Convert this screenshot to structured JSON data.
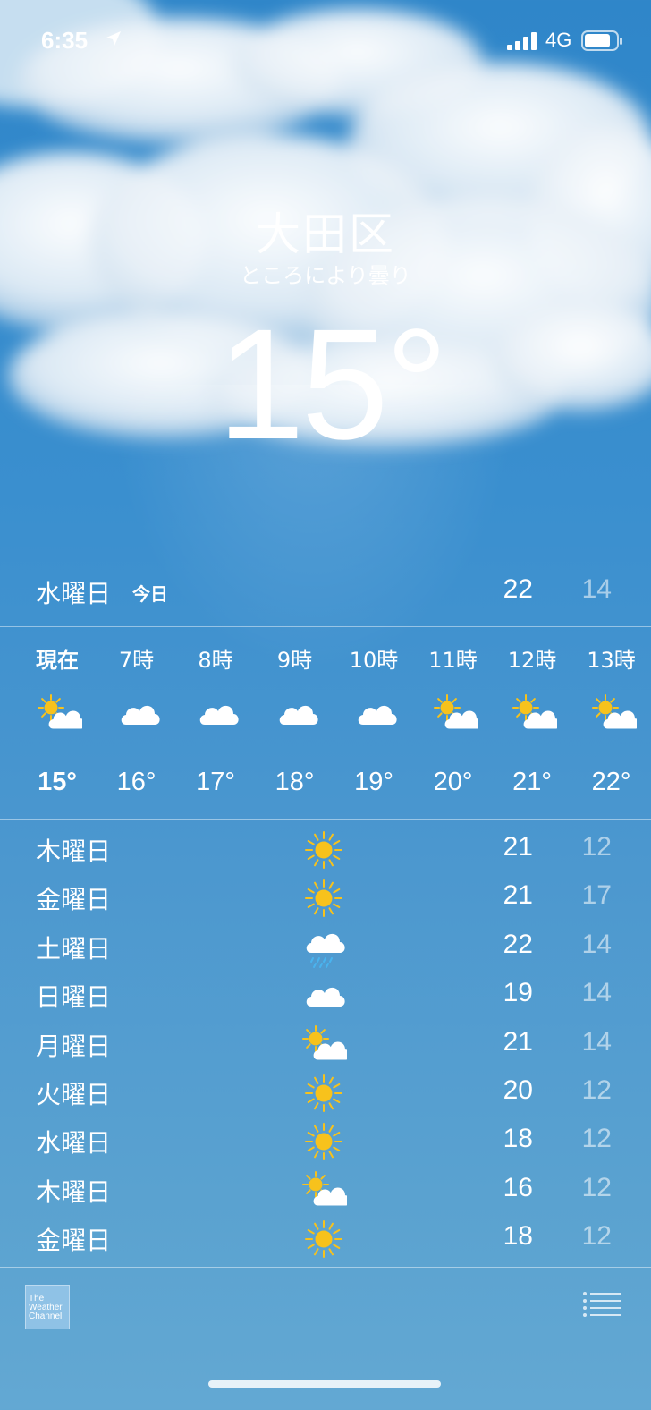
{
  "status_bar": {
    "time": "6:35",
    "network": "4G"
  },
  "location": {
    "city": "大田区",
    "condition": "ところにより曇り",
    "temperature": "15°"
  },
  "today": {
    "day": "水曜日",
    "label": "今日",
    "high": "22",
    "low": "14"
  },
  "hourly": [
    {
      "time": "現在",
      "icon": "partly-sunny-icon",
      "temp": "15°"
    },
    {
      "time": "7時",
      "icon": "cloud-icon",
      "temp": "16°"
    },
    {
      "time": "8時",
      "icon": "cloud-icon",
      "temp": "17°"
    },
    {
      "time": "9時",
      "icon": "cloud-icon",
      "temp": "18°"
    },
    {
      "time": "10時",
      "icon": "cloud-icon",
      "temp": "19°"
    },
    {
      "time": "11時",
      "icon": "partly-sunny-icon",
      "temp": "20°"
    },
    {
      "time": "12時",
      "icon": "partly-sunny-icon",
      "temp": "21°"
    },
    {
      "time": "13時",
      "icon": "partly-sunny-icon",
      "temp": "22°"
    }
  ],
  "daily": [
    {
      "day": "木曜日",
      "icon": "sun-icon",
      "high": "21",
      "low": "12"
    },
    {
      "day": "金曜日",
      "icon": "sun-icon",
      "high": "21",
      "low": "17"
    },
    {
      "day": "土曜日",
      "icon": "rain-cloud-icon",
      "high": "22",
      "low": "14"
    },
    {
      "day": "日曜日",
      "icon": "cloud-icon",
      "high": "19",
      "low": "14"
    },
    {
      "day": "月曜日",
      "icon": "partly-sunny-icon",
      "high": "21",
      "low": "14"
    },
    {
      "day": "火曜日",
      "icon": "sun-icon",
      "high": "20",
      "low": "12"
    },
    {
      "day": "水曜日",
      "icon": "sun-icon",
      "high": "18",
      "low": "12"
    },
    {
      "day": "木曜日",
      "icon": "partly-sunny-icon",
      "high": "16",
      "low": "12"
    },
    {
      "day": "金曜日",
      "icon": "sun-icon",
      "high": "18",
      "low": "12"
    }
  ],
  "footer": {
    "logo_text": "The Weather Channel"
  },
  "colors": {
    "sun": "#f7c21c",
    "rain": "#49b4ef",
    "sky_top": "#2f86c9",
    "sky_bottom": "#63a8d3"
  }
}
